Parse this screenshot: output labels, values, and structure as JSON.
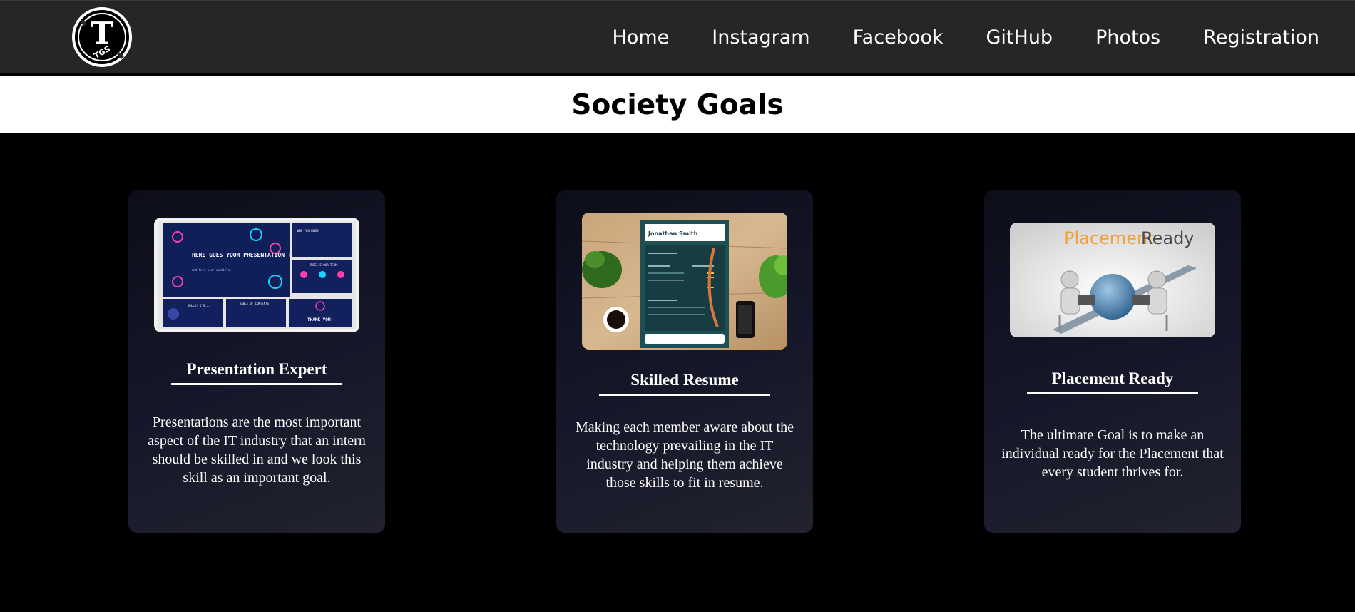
{
  "logo": {
    "letter": "T",
    "sub": "TGS"
  },
  "nav": {
    "items": [
      {
        "label": "Home"
      },
      {
        "label": "Instagram"
      },
      {
        "label": "Facebook"
      },
      {
        "label": "GitHub"
      },
      {
        "label": "Photos"
      },
      {
        "label": "Registration"
      }
    ]
  },
  "page": {
    "title": "Society Goals"
  },
  "cards": [
    {
      "title": "Presentation Expert",
      "description": "Presentations are the most important aspect of the IT industry that an intern should be skilled in and we look this skill as an important goal.",
      "image": {
        "main_title": "HERE GOES YOUR PRESENTATION TITLE",
        "main_sub": "And here your subtitle.",
        "slide_who": "WHO YOU KNOW?",
        "slide_team": "THIS IS OUR TEAM.",
        "slide_hello": "HELLO! I'M...",
        "slide_toc": "TABLE OF CONTENTS",
        "slide_thanks": "THANK YOU!"
      }
    },
    {
      "title": "Skilled Resume",
      "description": "Making each member aware about the technology prevailing in the IT industry and helping them achieve those skills to fit in resume.",
      "image": {
        "name": "Jonathan Smith"
      }
    },
    {
      "title": "Placement Ready",
      "description": "The ultimate Goal is to make an individual ready for the Placement that every student thrives for.",
      "image": {
        "brand_a": "Placement",
        "brand_b": "Ready"
      }
    }
  ]
}
